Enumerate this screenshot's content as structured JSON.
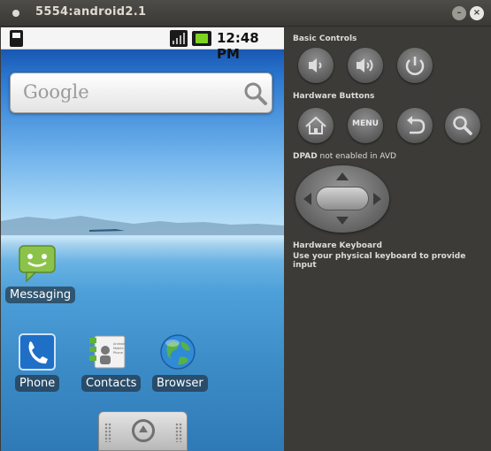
{
  "window": {
    "title": "5554:android2.1"
  },
  "status_bar": {
    "time": "12:48 PM"
  },
  "search": {
    "placeholder": "Google"
  },
  "apps": {
    "messaging": {
      "label": "Messaging"
    },
    "phone": {
      "label": "Phone"
    },
    "contacts": {
      "label": "Contacts",
      "card_text": "Android Mobile Phone"
    },
    "browser": {
      "label": "Browser"
    }
  },
  "panel": {
    "basic_controls": "Basic Controls",
    "hardware_buttons": "Hardware Buttons",
    "menu_label": "MENU",
    "dpad_bold": "DPAD",
    "dpad_note": " not enabled in AVD",
    "keyboard_title": "Hardware Keyboard",
    "keyboard_note": "Use your physical keyboard to provide input"
  },
  "colors": {
    "panel_bg": "#3c3b37",
    "battery": "#7ed321",
    "messaging": "#8bc34a"
  },
  "icons": [
    "sd-card-icon",
    "signal-icon",
    "battery-icon",
    "search-icon",
    "volume-down-icon",
    "volume-up-icon",
    "power-icon",
    "home-icon",
    "back-icon",
    "search-hw-icon"
  ]
}
